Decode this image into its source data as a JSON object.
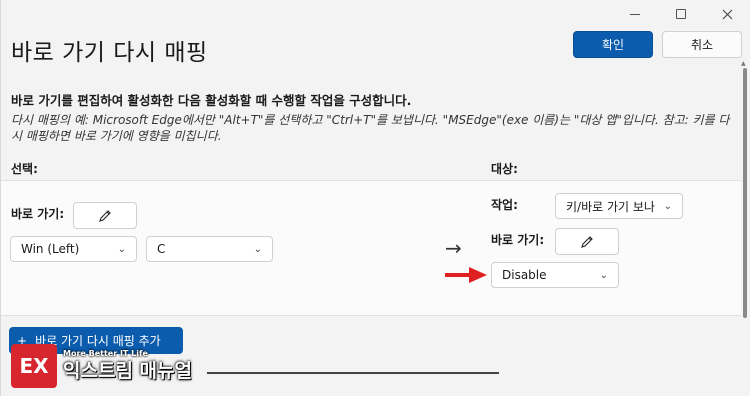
{
  "window": {
    "title": "바로 가기 다시 매핑",
    "confirm_label": "확인",
    "cancel_label": "취소"
  },
  "description": {
    "heading": "바로 가기를 편집하여 활성화한 다음 활성화할 때 수행할 작업을 구성합니다.",
    "example": "다시 매핑의 예: Microsoft Edge에서만 \"Alt+T\"를 선택하고 \"Ctrl+T\"를 보냅니다. \"MSEdge\"(exe 이름)는 \"대상 앱\"입니다. 참고: 키를 다시 매핑하면 바로 가기에 영향을 미칩니다."
  },
  "selection": {
    "header": "선택:",
    "shortcut_label": "바로 가기:",
    "key1": "Win (Left)",
    "key2": "C"
  },
  "target": {
    "header": "대상:",
    "action_label": "작업:",
    "action_value": "키/바로 가기 보나",
    "shortcut_label": "바로 가기:",
    "key_value": "Disable"
  },
  "add_button_label": "바로 가기 다시 매핑 추가",
  "watermark": {
    "tagline": "More Better IT Life",
    "name": "익스트림 매뉴얼",
    "logo_letters": "EX"
  },
  "colors": {
    "accent": "#0b5cad",
    "red_arrow": "#e02020",
    "logo_red": "#d7262e"
  }
}
